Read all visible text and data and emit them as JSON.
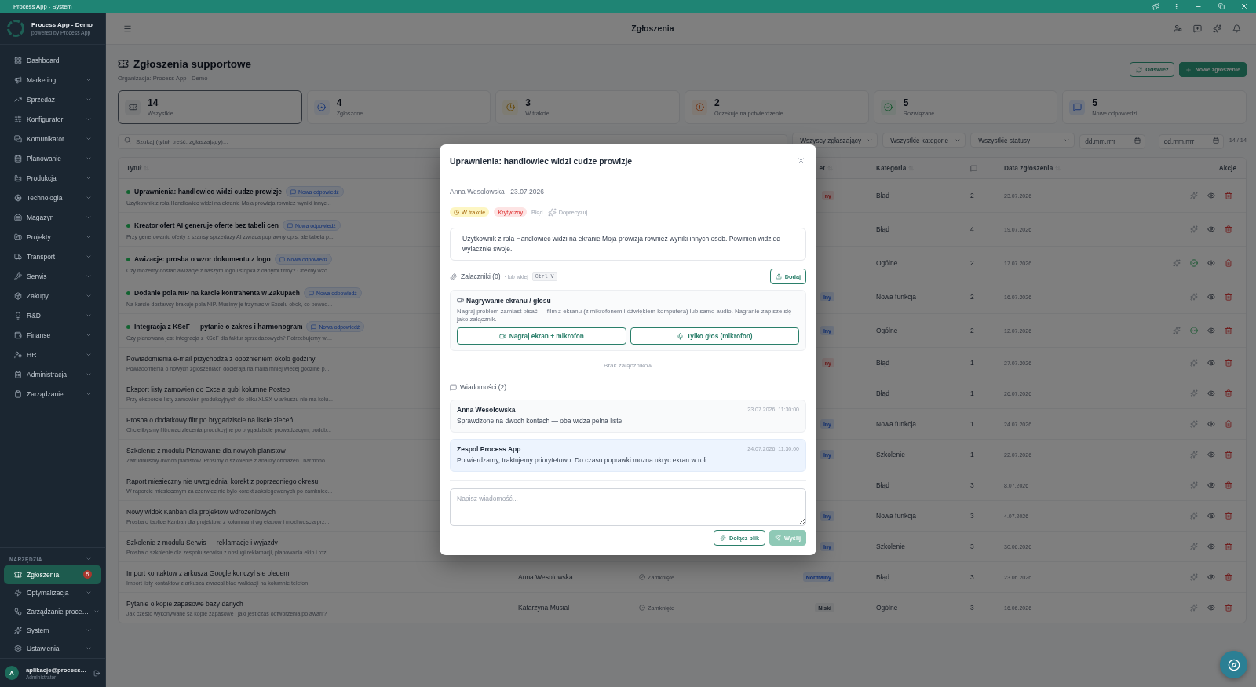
{
  "title_bar": {
    "title": "Process App - System"
  },
  "sidebar": {
    "app_name": "Process App - Demo",
    "app_tagline": "powered by Process App",
    "items": [
      {
        "label": "Dashboard",
        "kind": "link",
        "selected": false
      },
      {
        "label": "Marketing",
        "kind": "group",
        "selected": false
      },
      {
        "label": "Sprzedaż",
        "kind": "group",
        "selected": false
      },
      {
        "label": "Konfigurator",
        "kind": "group",
        "selected": false
      },
      {
        "label": "Komunikator",
        "kind": "group",
        "selected": false
      },
      {
        "label": "Planowanie",
        "kind": "group",
        "selected": false
      },
      {
        "label": "Produkcja",
        "kind": "group",
        "selected": false
      },
      {
        "label": "Technologia",
        "kind": "group",
        "selected": false
      },
      {
        "label": "Magazyn",
        "kind": "group",
        "selected": false
      },
      {
        "label": "Projekty",
        "kind": "group",
        "selected": false
      },
      {
        "label": "Transport",
        "kind": "group",
        "selected": false
      },
      {
        "label": "Serwis",
        "kind": "group",
        "selected": false
      },
      {
        "label": "Zakupy",
        "kind": "group",
        "selected": false
      },
      {
        "label": "R&D",
        "kind": "group",
        "selected": false
      },
      {
        "label": "Finanse",
        "kind": "group",
        "selected": false
      },
      {
        "label": "HR",
        "kind": "group",
        "selected": false
      },
      {
        "label": "Administracja",
        "kind": "group",
        "selected": false
      },
      {
        "label": "Zarządzanie",
        "kind": "group",
        "selected": false
      }
    ],
    "tools": {
      "heading": "NARZĘDZIA",
      "items": [
        {
          "label": "Zgłoszenia",
          "kind": "link",
          "selected": true,
          "count": "5"
        },
        {
          "label": "Optymalizacja",
          "kind": "group",
          "selected": false
        },
        {
          "label": "Zarządzanie proce…",
          "kind": "group",
          "selected": false
        },
        {
          "label": "System",
          "kind": "group",
          "selected": false
        },
        {
          "label": "Ustawienia",
          "kind": "group",
          "selected": false
        }
      ]
    },
    "user": {
      "initial": "A",
      "name": "aplikacje@process…",
      "role": "Administrator"
    }
  },
  "top_bar": {
    "title": "Zgłoszenia"
  },
  "page": {
    "heading": "Zgłoszenia supportowe",
    "organization": "Organizacja: Process App - Demo",
    "refresh_button": "Odśwież",
    "new_button": "Nowe zgłoszenie"
  },
  "stats": [
    {
      "kind": "all",
      "value": "14",
      "label": "Wszystkie",
      "selected": true
    },
    {
      "kind": "reported",
      "value": "4",
      "label": "Zgłoszone",
      "selected": false
    },
    {
      "kind": "in_progress",
      "value": "3",
      "label": "W trakcie",
      "selected": false
    },
    {
      "kind": "awaiting",
      "value": "2",
      "label": "Oczekuje na potwierdzenie",
      "selected": false
    },
    {
      "kind": "resolved",
      "value": "5",
      "label": "Rozwiązane",
      "selected": false
    },
    {
      "kind": "replies",
      "value": "5",
      "label": "Nowe odpowiedzi",
      "selected": false
    }
  ],
  "filters": {
    "search": {
      "placeholder": "Szukaj (tytuł, treść, zgłaszający)..."
    },
    "dropdowns": [
      "Wszyscy zgłaszający",
      "Wszystkie kategorie",
      "Wszystkie statusy"
    ],
    "date_from": {
      "placeholder": "dd.mm.rrrr"
    },
    "date_separator": "–",
    "date_to": {
      "placeholder": "dd.mm.rrrr"
    },
    "result_count": "14 / 14"
  },
  "table": {
    "columns": [
      {
        "label": "Tytuł",
        "sortable": true
      },
      {
        "label": "et",
        "sortable": true
      },
      {
        "label": "Kategoria",
        "sortable": true
      },
      {
        "label": "Data zgłoszenia",
        "sortable": true
      },
      {
        "label": "Akcje",
        "sortable": false
      }
    ],
    "rows": [
      {
        "title": "Uprawnienia: handlowiec widzi cudze prowizje",
        "unread": true,
        "badge": "Nowa odpowiedź",
        "preview": "Uzytkownik z rola Handlowiec widzi na ekranie Moja prowizja rowniez wyniki innyc...",
        "column_4": {
          "label": "ny",
          "kind": "critical"
        },
        "category": "Błąd",
        "comments": "2",
        "date": "23.07.2026",
        "confirmable": false
      },
      {
        "title": "Kreator ofert AI generuje oferte bez tabeli cen",
        "unread": true,
        "badge": "Nowa odpowiedź",
        "preview": "Przy generowaniu oferty z szansy sprzedazy AI zwraca poprawny opis, ale tabela p...",
        "category": "Błąd",
        "comments": "4",
        "date": "19.07.2026",
        "confirmable": false
      },
      {
        "title": "Awizacje: prosba o wzor dokumentu z logo",
        "unread": true,
        "badge": "Nowa odpowiedź",
        "preview": "Czy mozemy dostac awizacje z naszym logo i stopka z danymi firmy? Obecny wzo...",
        "category": "Ogólne",
        "comments": "2",
        "date": "17.07.2026",
        "confirmable": true
      },
      {
        "title": "Dodanie pola NIP na karcie kontrahenta w Zakupach",
        "unread": true,
        "badge": "Nowa odpowiedź",
        "preview": "Na karcie dostawcy brakuje pola NIP. Musimy je trzymac w Excelu obok, co powod...",
        "column_4": {
          "label": "lny",
          "kind": "normal"
        },
        "category": "Nowa funkcja",
        "comments": "2",
        "date": "16.07.2026",
        "confirmable": false
      },
      {
        "title": "Integracja z KSeF — pytanie o zakres i harmonogram",
        "unread": true,
        "badge": "Nowa odpowiedź",
        "preview": "Czy planowana jest integracja z KSeF dla faktur sprzedazowych? Potrzebujemy wi...",
        "column_4": {
          "label": "lny",
          "kind": "normal"
        },
        "category": "Ogólne",
        "comments": "2",
        "date": "12.07.2026",
        "confirmable": true
      },
      {
        "title": "Powiadomienia e-mail przychodza z opoznieniem okolo godziny",
        "unread": false,
        "preview": "Powiadomienia o nowych zgloszeniach docieraja na maila mniej wiecej godzine p...",
        "column_4": {
          "label": "ny",
          "kind": "critical"
        },
        "category": "Błąd",
        "comments": "1",
        "date": "27.07.2026",
        "confirmable": false
      },
      {
        "title": "Eksport listy zamowien do Excela gubi kolumne Postep",
        "unread": false,
        "preview": "Przy eksporcie listy zamowien produkcyjnych do pliku XLSX w arkuszu nie ma kolu...",
        "category": "Błąd",
        "comments": "1",
        "date": "26.07.2026",
        "confirmable": false
      },
      {
        "title": "Prosba o dodatkowy filtr po brygadziscie na liscie zleceń",
        "unread": false,
        "preview": "Chcielibysmy filtrowac zlecenia produkcyjne po brygadziscie prowadzacym, podob...",
        "column_4": {
          "label": "lny",
          "kind": "normal"
        },
        "category": "Nowa funkcja",
        "comments": "1",
        "date": "24.07.2026",
        "confirmable": false
      },
      {
        "title": "Szkolenie z modulu Planowanie dla nowych planistow",
        "unread": false,
        "preview": "Zatrudnilismy dwoch planistow. Prosimy o szkolenie z analizy obciazen i harmono...",
        "column_4": {
          "label": "lny",
          "kind": "normal"
        },
        "category": "Szkolenie",
        "comments": "1",
        "date": "22.07.2026",
        "confirmable": false
      },
      {
        "title": "Raport miesieczny nie uwzglednial korekt z poprzedniego okresu",
        "unread": false,
        "preview": "W raporcie miesiecznym za czerwiec nie bylo korekt zaksiegowanych po zamkniec...",
        "category": "Błąd",
        "comments": "3",
        "date": "8.07.2026",
        "confirmable": false
      },
      {
        "title": "Nowy widok Kanban dla projektow wdrozeniowych",
        "unread": false,
        "preview": "Prosba o tablice Kanban dla projektow, z kolumnami wg etapow i mozliwoscia prz...",
        "column_4": {
          "label": "lny",
          "kind": "normal"
        },
        "category": "Nowa funkcja",
        "comments": "3",
        "date": "4.07.2026",
        "confirmable": false
      },
      {
        "title": "Szkolenie z modulu Serwis — reklamacje i wyjazdy",
        "unread": false,
        "preview": "Prosba o szkolenie dla zespolu serwisu z obslugi reklamacji, planowania ekip i rozl...",
        "column_4": {
          "label": "lny",
          "kind": "normal"
        },
        "category": "Szkolenie",
        "comments": "3",
        "date": "30.06.2026",
        "confirmable": false
      },
      {
        "title": "Import kontaktow z arkusza Google konczyl sie bledem",
        "unread": false,
        "preview": "Import listy kontaktow z arkusza zwracal blad walidacji na kolumnie telefon",
        "column_2": "Anna Wesolowska",
        "column_3": "Zamknięte",
        "column_4": {
          "label": "Normalny",
          "kind": "normal"
        },
        "category": "Błąd",
        "comments": "3",
        "date": "23.06.2026",
        "confirmable": false
      },
      {
        "title": "Pytanie o kopie zapasowe bazy danych",
        "unread": false,
        "preview": "Jak czesto wykonywane sa kopie zapasowe i jaki jest czas odtworzenia po awarii?",
        "column_2": "Katarzyna Musial",
        "column_3": "Zamknięte",
        "column_4": {
          "label": "Niski",
          "kind": "low"
        },
        "category": "Ogólne",
        "comments": "3",
        "date": "16.06.2026",
        "confirmable": false
      }
    ]
  },
  "modal": {
    "title": "Uprawnienia: handlowiec widzi cudze prowizje",
    "meta": "Anna Wesolowska · 23.07.2026",
    "status": {
      "label": "W trakcie",
      "kind": "in_progress"
    },
    "priority": {
      "label": "Krytyczny",
      "kind": "critical"
    },
    "category": "Błąd",
    "refine_button": "Doprecyzuj",
    "description": "Uzytkownik z rola Handlowiec widzi na ekranie Moja prowizja rowniez wyniki innych osob. Powinien widziec wylacznie swoje.",
    "attachments": {
      "title": "Załączniki (0)",
      "paste_hint": "· lub wklej",
      "shortcut": "Ctrl+V",
      "add_button": "Dodaj",
      "empty": "Brak załączników"
    },
    "recording": {
      "title": "Nagrywanie ekranu / głosu",
      "description": "Nagraj problem zamiast pisać — film z ekranu (z mikrofonem i dźwiękiem komputera) lub samo audio. Nagranie zapisze się jako załącznik.",
      "buttons": [
        "Nagraj ekran + mikrofon",
        "Tylko głos (mikrofon)"
      ]
    },
    "messages_title": "Wiadomości (2)",
    "messages": [
      {
        "author": "Anna Wesolowska",
        "time": "23.07.2026, 11:30:00",
        "text": "Sprawdzone na dwoch kontach — oba widza pelna liste.",
        "from_team": false
      },
      {
        "author": "Zespol Process App",
        "time": "24.07.2026, 11:30:00",
        "text": "Potwierdzamy, traktujemy priorytetowo. Do czasu poprawki mozna ukryc ekran w roli.",
        "from_team": true
      }
    ],
    "reply": {
      "placeholder": "Napisz wiadomość...",
      "attach_button": "Dołącz plik",
      "send_button": {
        "label": "Wyślij",
        "disabled": true
      }
    }
  }
}
